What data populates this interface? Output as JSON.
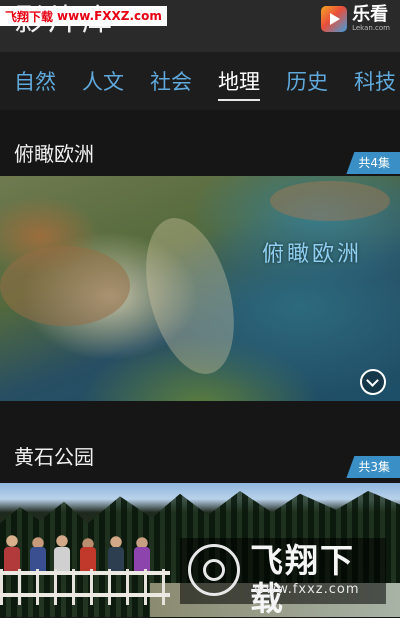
{
  "watermark_top": {
    "site_name": "飞翔下载",
    "url": "www.FXXZ.com"
  },
  "header": {
    "title": "影片库",
    "logo_name": "乐看",
    "logo_sub": "Lekan.com"
  },
  "tabs": [
    {
      "label": "自然",
      "active": false
    },
    {
      "label": "人文",
      "active": false
    },
    {
      "label": "社会",
      "active": false
    },
    {
      "label": "地理",
      "active": true
    },
    {
      "label": "历史",
      "active": false
    },
    {
      "label": "科技",
      "active": false
    }
  ],
  "sections": [
    {
      "title": "俯瞰欧洲",
      "episodes": "共4集",
      "overlay_title": "俯瞰欧洲",
      "thumb_icon": "chevron-down-icon"
    },
    {
      "title": "黄石公园",
      "episodes": "共3集"
    }
  ],
  "watermark_bottom": {
    "title": "飞翔下载",
    "url": "www.fxxz.com"
  },
  "colors": {
    "accent": "#5fa9dd",
    "badge": "#3b8fc7",
    "background": "#161616"
  }
}
